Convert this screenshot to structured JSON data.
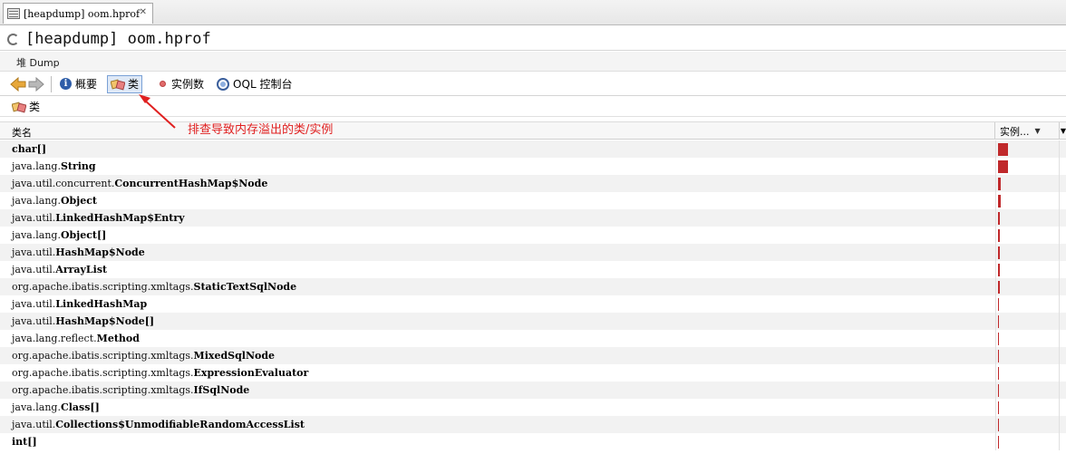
{
  "tab": {
    "title": "[heapdump] oom.hprof",
    "close": "✕"
  },
  "header": {
    "title": "[heapdump] oom.hprof"
  },
  "subheader": {
    "label": "堆 Dump"
  },
  "toolbar": {
    "summary_label": "概要",
    "classes_label": "类",
    "instances_label": "实例数",
    "oql_label": "OQL 控制台"
  },
  "panel": {
    "title": "类"
  },
  "annotation": {
    "text": "排查导致内存溢出的类/实例",
    "color": "#e02020"
  },
  "table": {
    "col_name": "类名",
    "col_instances": "实例...",
    "sort_indicator": "▼",
    "extra_col": "▼",
    "bar_color": "#c0292b",
    "rows": [
      {
        "pkg": "",
        "cls": "char[]",
        "share": 1.0
      },
      {
        "pkg": "java.lang.",
        "cls": "String",
        "share": 0.98
      },
      {
        "pkg": "java.util.concurrent.",
        "cls": "ConcurrentHashMap$Node",
        "share": 0.28
      },
      {
        "pkg": "java.lang.",
        "cls": "Object",
        "share": 0.25
      },
      {
        "pkg": "java.util.",
        "cls": "LinkedHashMap$Entry",
        "share": 0.22
      },
      {
        "pkg": "java.lang.",
        "cls": "Object[]",
        "share": 0.22
      },
      {
        "pkg": "java.util.",
        "cls": "HashMap$Node",
        "share": 0.2
      },
      {
        "pkg": "java.util.",
        "cls": "ArrayList",
        "share": 0.18
      },
      {
        "pkg": "org.apache.ibatis.scripting.xmltags.",
        "cls": "StaticTextSqlNode",
        "share": 0.17
      },
      {
        "pkg": "java.util.",
        "cls": "LinkedHashMap",
        "share": 0.1
      },
      {
        "pkg": "java.util.",
        "cls": "HashMap$Node[]",
        "share": 0.1
      },
      {
        "pkg": "java.lang.reflect.",
        "cls": "Method",
        "share": 0.1
      },
      {
        "pkg": "org.apache.ibatis.scripting.xmltags.",
        "cls": "MixedSqlNode",
        "share": 0.1
      },
      {
        "pkg": "org.apache.ibatis.scripting.xmltags.",
        "cls": "ExpressionEvaluator",
        "share": 0.1
      },
      {
        "pkg": "org.apache.ibatis.scripting.xmltags.",
        "cls": "IfSqlNode",
        "share": 0.1
      },
      {
        "pkg": "java.lang.",
        "cls": "Class[]",
        "share": 0.1
      },
      {
        "pkg": "java.util.",
        "cls": "Collections$UnmodifiableRandomAccessList",
        "share": 0.1
      },
      {
        "pkg": "",
        "cls": "int[]",
        "share": 0.1
      }
    ]
  }
}
